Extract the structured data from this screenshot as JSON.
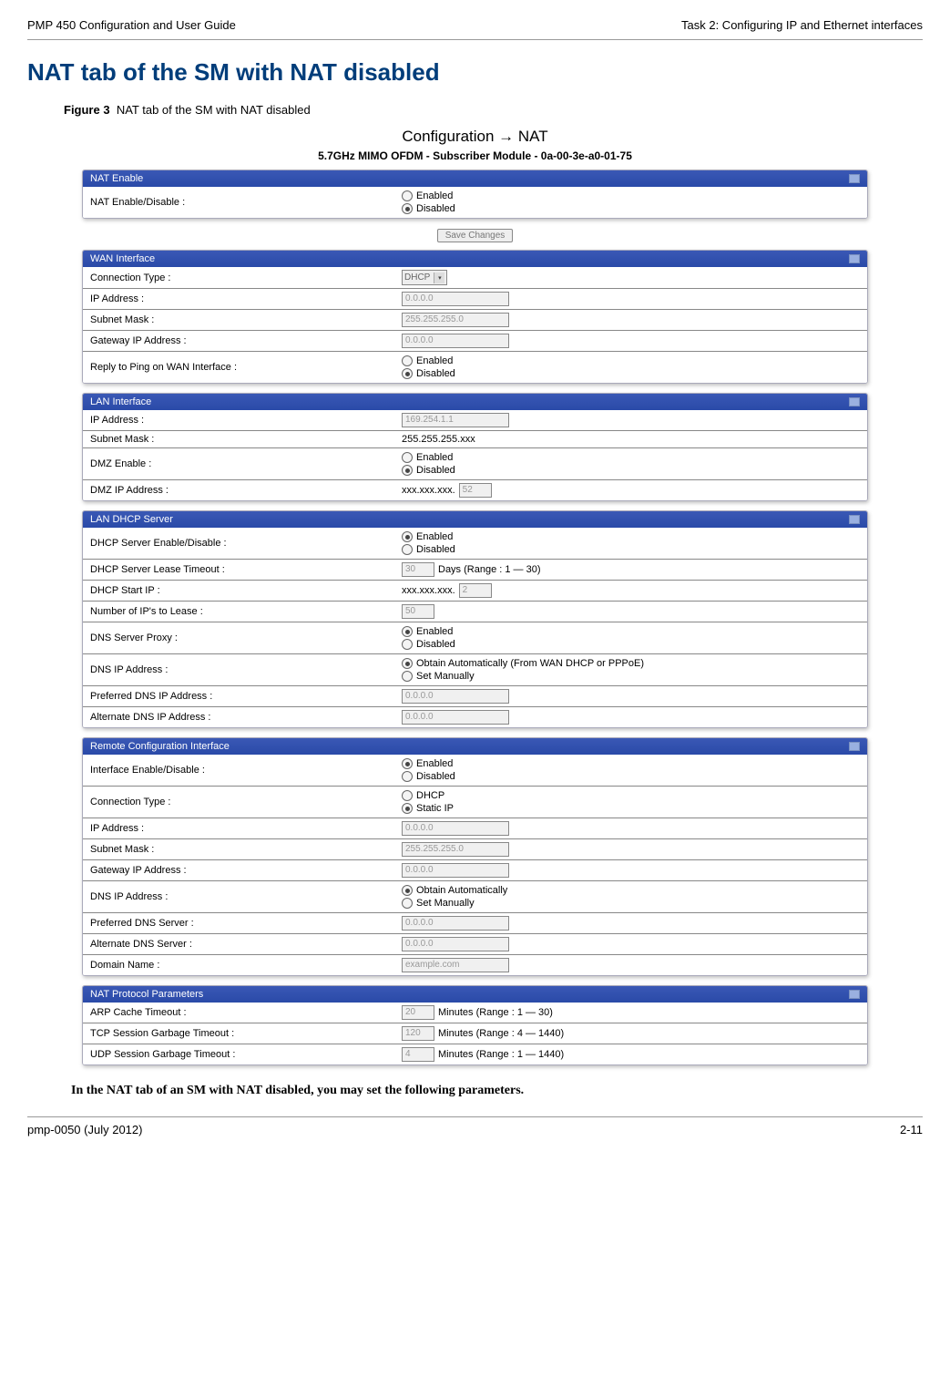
{
  "header": {
    "left": "PMP 450 Configuration and User Guide",
    "right": "Task 2: Configuring IP and Ethernet interfaces"
  },
  "section_title": "NAT tab of the SM with NAT disabled",
  "figure_label": "Figure 3",
  "figure_caption": "NAT tab of the SM with NAT disabled",
  "breadcrumb": "Configuration → NAT",
  "device_title": "5.7GHz MIMO OFDM - Subscriber Module - 0a-00-3e-a0-01-75",
  "save_button": "Save Changes",
  "labels": {
    "enabled": "Enabled",
    "disabled": "Disabled",
    "dhcp_opt": "DHCP",
    "staticip_opt": "Static IP",
    "obtain_wan": "Obtain Automatically (From WAN DHCP or PPPoE)",
    "obtain_auto": "Obtain Automatically",
    "set_manually": "Set Manually"
  },
  "panels": {
    "nat_enable": {
      "title": "NAT Enable",
      "r0_label": "NAT Enable/Disable :"
    },
    "wan": {
      "title": "WAN Interface",
      "r0_label": "Connection Type :",
      "r0_value": "DHCP",
      "r1_label": "IP Address :",
      "r1_value": "0.0.0.0",
      "r2_label": "Subnet Mask :",
      "r2_value": "255.255.255.0",
      "r3_label": "Gateway IP Address :",
      "r3_value": "0.0.0.0",
      "r4_label": "Reply to Ping on WAN Interface :"
    },
    "lan": {
      "title": "LAN Interface",
      "r0_label": "IP Address :",
      "r0_value": "169.254.1.1",
      "r1_label": "Subnet Mask :",
      "r1_value": "255.255.255.xxx",
      "r2_label": "DMZ Enable :",
      "r3_label": "DMZ IP Address :",
      "r3_prefix": "xxx.xxx.xxx.",
      "r3_value": "52"
    },
    "dhcp": {
      "title": "LAN DHCP Server",
      "r0_label": "DHCP Server Enable/Disable :",
      "r1_label": "DHCP Server Lease Timeout :",
      "r1_value": "30",
      "r1_suffix": "Days (Range : 1 — 30)",
      "r2_label": "DHCP Start IP :",
      "r2_prefix": "xxx.xxx.xxx.",
      "r2_value": "2",
      "r3_label": "Number of IP's to Lease :",
      "r3_value": "50",
      "r4_label": "DNS Server Proxy :",
      "r5_label": "DNS IP Address :",
      "r6_label": "Preferred DNS IP Address :",
      "r6_value": "0.0.0.0",
      "r7_label": "Alternate DNS IP Address :",
      "r7_value": "0.0.0.0"
    },
    "remote": {
      "title": "Remote Configuration Interface",
      "r0_label": "Interface Enable/Disable :",
      "r1_label": "Connection Type :",
      "r2_label": "IP Address :",
      "r2_value": "0.0.0.0",
      "r3_label": "Subnet Mask :",
      "r3_value": "255.255.255.0",
      "r4_label": "Gateway IP Address :",
      "r4_value": "0.0.0.0",
      "r5_label": "DNS IP Address :",
      "r6_label": "Preferred DNS Server :",
      "r6_value": "0.0.0.0",
      "r7_label": "Alternate DNS Server :",
      "r7_value": "0.0.0.0",
      "r8_label": "Domain Name :",
      "r8_value": "example.com"
    },
    "natproto": {
      "title": "NAT Protocol Parameters",
      "r0_label": "ARP Cache Timeout :",
      "r0_value": "20",
      "r0_suffix": "Minutes (Range : 1 — 30)",
      "r1_label": "TCP Session Garbage Timeout :",
      "r1_value": "120",
      "r1_suffix": "Minutes (Range : 4 — 1440)",
      "r2_label": "UDP Session Garbage Timeout :",
      "r2_value": "4",
      "r2_suffix": "Minutes (Range : 1 — 1440)"
    }
  },
  "body_note": "In the NAT tab of an SM with NAT disabled, you may set the following parameters.",
  "footer": {
    "left": "pmp-0050 (July 2012)",
    "right": "2-11"
  }
}
